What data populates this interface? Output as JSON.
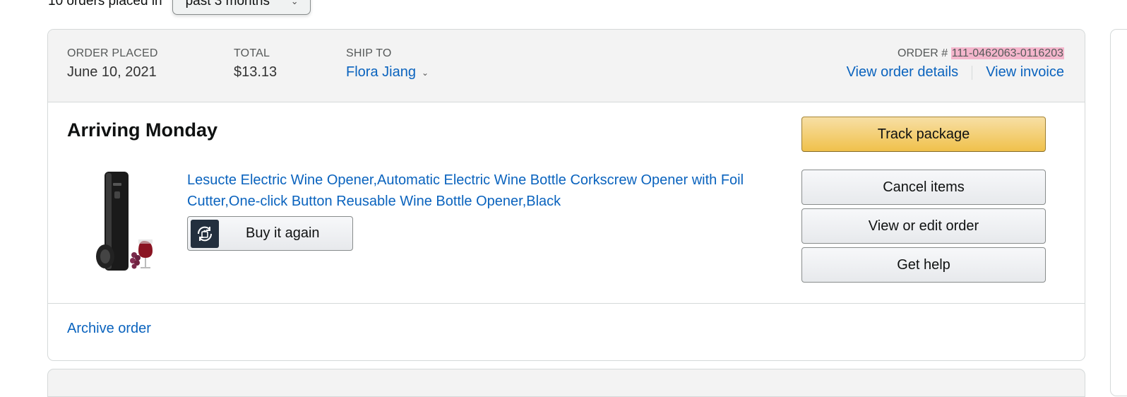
{
  "filter": {
    "text": "10 orders placed in",
    "selected": "past 3 months"
  },
  "order": {
    "header": {
      "placed_label": "ORDER PLACED",
      "placed_value": "June 10, 2021",
      "total_label": "TOTAL",
      "total_value": "$13.13",
      "ship_label": "SHIP TO",
      "ship_value": "Flora Jiang",
      "order_num_label": "ORDER #",
      "order_num_value": "111-0462063-0116203",
      "view_details": "View order details",
      "view_invoice": "View invoice"
    },
    "status": "Arriving Monday",
    "product": {
      "title": "Lesucte Electric Wine Opener,Automatic Electric Wine Bottle Corkscrew Opener with Foil Cutter,One-click Button Reusable Wine Bottle Opener,Black",
      "buy_again": "Buy it again"
    },
    "actions": {
      "track": "Track package",
      "cancel": "Cancel items",
      "view_edit": "View or edit order",
      "help": "Get help"
    },
    "footer": {
      "archive": "Archive order"
    }
  },
  "colors": {
    "link": "#0a63be",
    "primary_button": "#f0c14b",
    "highlight": "#f4b6cc",
    "header_bg": "#f3f3f3"
  }
}
